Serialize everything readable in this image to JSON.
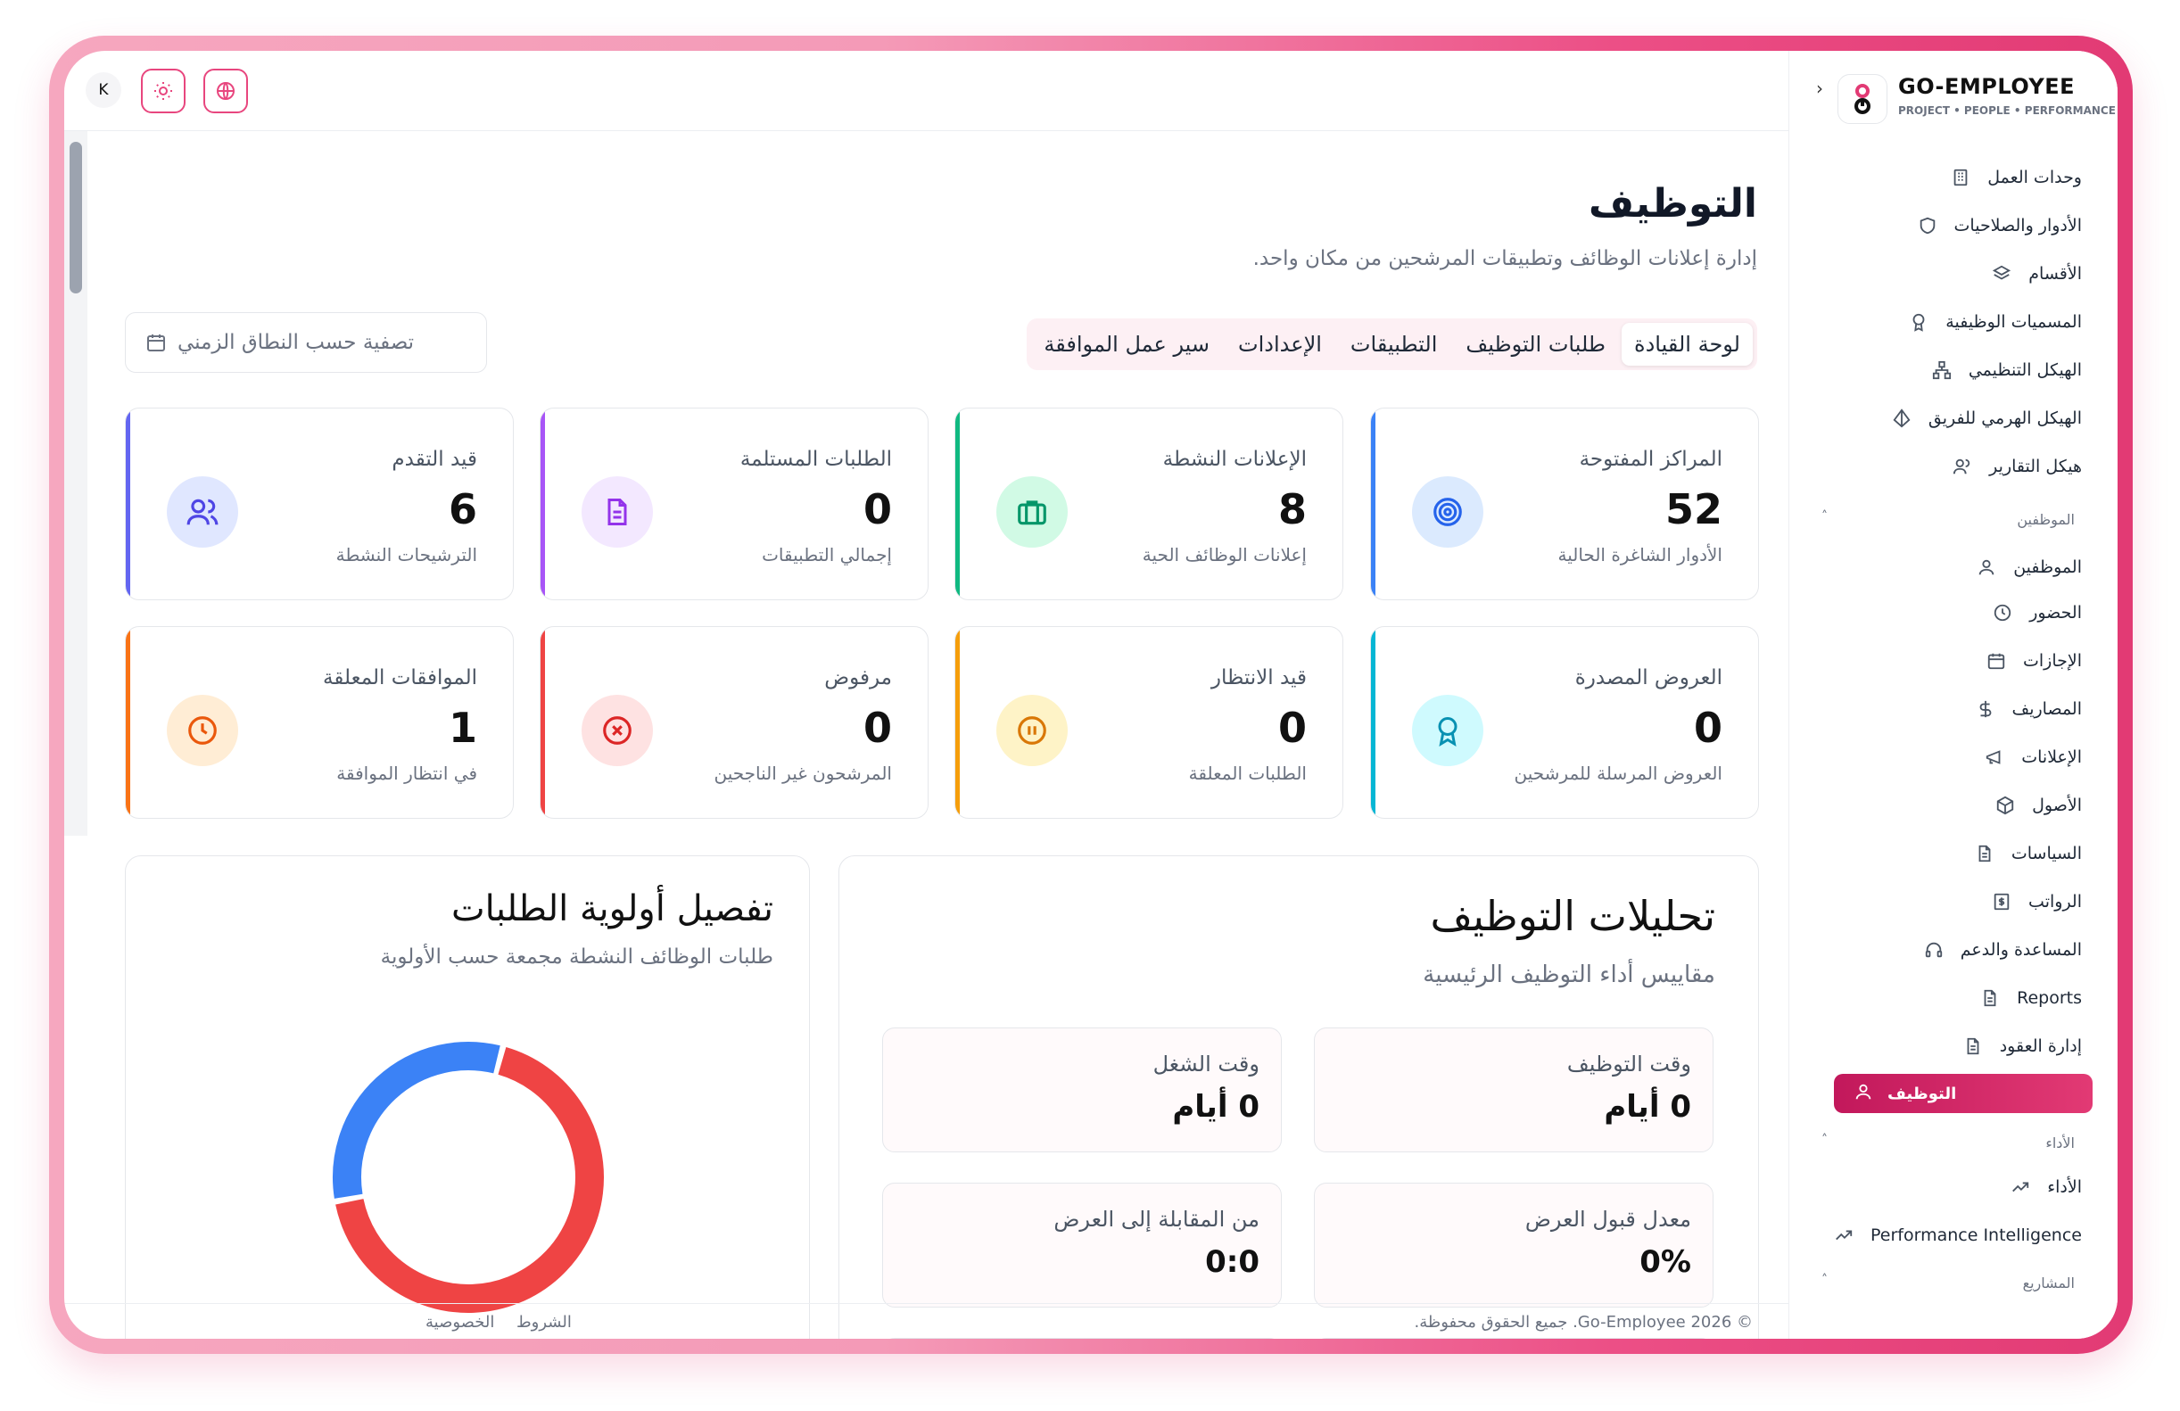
{
  "topbar": {
    "user_initial": "K"
  },
  "page": {
    "title": "التوظيف",
    "subtitle": "إدارة إعلانات الوظائف وتطبيقات المرشحين من مكان واحد.",
    "date_filter_placeholder": "تصفية حسب النطاق الزمني"
  },
  "tabs": [
    "لوحة القيادة",
    "طلبات التوظيف",
    "التطبيقات",
    "الإعدادات",
    "سير عمل الموافقة"
  ],
  "stats": [
    {
      "label": "المراكز المفتوحة",
      "value": "52",
      "sub": "الأدوار الشاغرة الحالية",
      "color": "#3b82f6",
      "icon": "target-icon"
    },
    {
      "label": "الإعلانات النشطة",
      "value": "8",
      "sub": "إعلانات الوظائف الحية",
      "color": "#10b981",
      "icon": "briefcase-icon"
    },
    {
      "label": "الطلبات المستلمة",
      "value": "0",
      "sub": "إجمالي التطبيقات",
      "color": "#a855f7",
      "icon": "document-icon"
    },
    {
      "label": "قيد التقدم",
      "value": "6",
      "sub": "الترشيحات النشطة",
      "color": "#6366f1",
      "icon": "users-icon"
    },
    {
      "label": "العروض المصدرة",
      "value": "0",
      "sub": "العروض المرسلة للمرشحين",
      "color": "#06b6d4",
      "icon": "award-icon"
    },
    {
      "label": "قيد الانتظار",
      "value": "0",
      "sub": "الطلبات المعلقة",
      "color": "#f59e0b",
      "icon": "pause-icon"
    },
    {
      "label": "مرفوض",
      "value": "0",
      "sub": "المرشحون غير الناجحين",
      "color": "#ef4444",
      "icon": "x-circle-icon"
    },
    {
      "label": "الموافقات المعلقة",
      "value": "1",
      "sub": "في انتظار الموافقة",
      "color": "#f97316",
      "icon": "clock-icon"
    }
  ],
  "analytics": {
    "title": "تحليلات التوظيف",
    "subtitle": "مقاييس أداء التوظيف الرئيسية",
    "metrics": [
      {
        "label": "وقت التوظيف",
        "value": "0 أيام"
      },
      {
        "label": "وقت الشغل",
        "value": "0 أيام"
      },
      {
        "label": "معدل قبول العرض",
        "value": "0%"
      },
      {
        "label": "من المقابلة إلى العرض",
        "value": "0:0"
      }
    ]
  },
  "priority": {
    "title": "تفصيل أولوية الطلبات",
    "subtitle": "طلبات الوظائف النشطة مجمعة حسب الأولوية"
  },
  "chart_data": {
    "type": "pie",
    "categories": [
      "",
      ""
    ],
    "values": [
      0.68,
      0.32
    ],
    "colors": [
      "#ef4444",
      "#3b82f6"
    ],
    "title": "تفصيل أولوية الطلبات"
  },
  "footer": {
    "copyright": "© Go-Employee 2026. جميع الحقوق محفوظة.",
    "terms": "الشروط",
    "privacy": "الخصوصية"
  },
  "sidebar": {
    "brand_name": "GO-EMPLOYEE",
    "brand_tagline": "PROJECT • PEOPLE • PERFORMANCE",
    "items_top": [
      {
        "label": "وحدات العمل",
        "icon": "building-icon"
      },
      {
        "label": "الأدوار والصلاحيات",
        "icon": "shield-icon"
      },
      {
        "label": "الأقسام",
        "icon": "layers-icon"
      },
      {
        "label": "المسميات الوظيفية",
        "icon": "badge-icon"
      },
      {
        "label": "الهيكل التنظيمي",
        "icon": "org-chart-icon"
      },
      {
        "label": "الهيكل الهرمي للفريق",
        "icon": "pyramid-icon"
      },
      {
        "label": "هيكل التقارير",
        "icon": "users-icon"
      }
    ],
    "section_employees": "الموظفين",
    "items_employees": [
      {
        "label": "الموظفين",
        "icon": "user-icon"
      },
      {
        "label": "الحضور",
        "icon": "clock-icon"
      },
      {
        "label": "الإجازات",
        "icon": "calendar-icon"
      },
      {
        "label": "المصاريف",
        "icon": "dollar-icon"
      },
      {
        "label": "الإعلانات",
        "icon": "megaphone-icon"
      },
      {
        "label": "الأصول",
        "icon": "box-icon"
      },
      {
        "label": "السياسات",
        "icon": "file-icon"
      },
      {
        "label": "الرواتب",
        "icon": "payroll-icon"
      },
      {
        "label": "المساعدة والدعم",
        "icon": "headset-icon"
      },
      {
        "label": "Reports",
        "icon": "report-icon"
      },
      {
        "label": "إدارة العقود",
        "icon": "contract-icon"
      }
    ],
    "active_item": "التوظيف",
    "section_performance": "الأداء",
    "items_performance": [
      {
        "label": "الأداء",
        "icon": "trend-icon"
      },
      {
        "label": "Performance Intelligence",
        "icon": "trend-icon"
      }
    ],
    "section_projects": "المشاريع"
  }
}
